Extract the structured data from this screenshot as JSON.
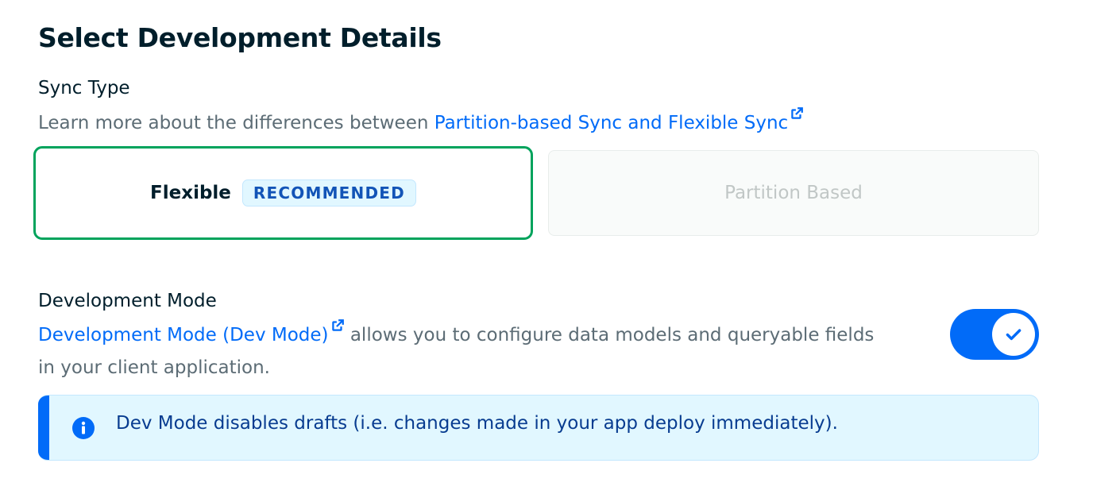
{
  "header": {
    "title": "Select Development Details"
  },
  "sync": {
    "label": "Sync Type",
    "description_prefix": "Learn more about the differences between ",
    "description_link": "Partition-based Sync and Flexible Sync",
    "options": [
      {
        "label": "Flexible",
        "badge": "RECOMMENDED",
        "selected": true
      },
      {
        "label": "Partition Based",
        "selected": false,
        "disabled": true
      }
    ]
  },
  "dev_mode": {
    "label": "Development Mode",
    "link": "Development Mode (Dev Mode)",
    "description": " allows you to configure data models and queryable fields in your client application.",
    "enabled": true
  },
  "callout": {
    "text": "Dev Mode disables drafts (i.e. changes made in your app deploy immediately)."
  },
  "colors": {
    "accent": "#016bf8",
    "selected_border": "#00a35c",
    "badge_bg": "#e1f7ff",
    "callout_bg": "#e1f7ff"
  },
  "icons": [
    "external-link-icon",
    "checkmark-icon",
    "info-icon"
  ]
}
